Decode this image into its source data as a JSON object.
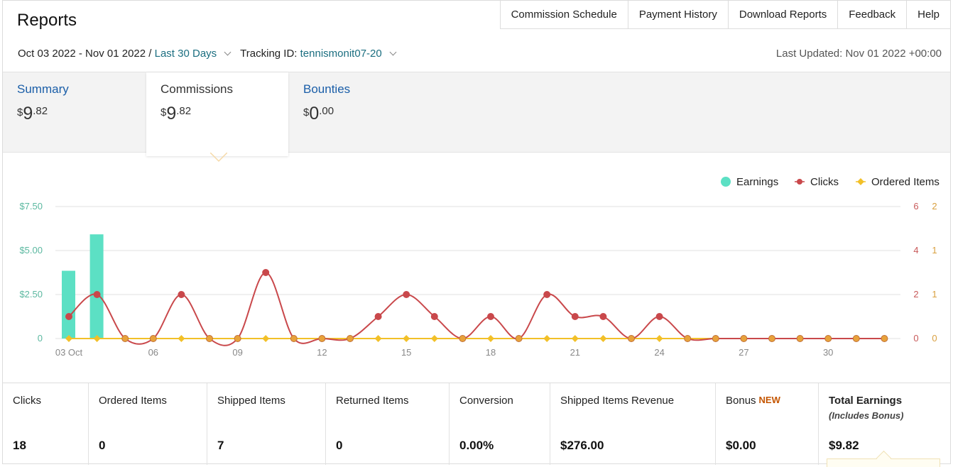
{
  "header": {
    "title": "Reports",
    "links": [
      "Commission Schedule",
      "Payment History",
      "Download Reports",
      "Feedback",
      "Help"
    ]
  },
  "filters": {
    "date_range": "Oct 03 2022 - Nov 01 2022 /",
    "period": "Last 30 Days",
    "tracking_label": "Tracking ID:",
    "tracking_id": "tennismonit07-20",
    "last_updated": "Last Updated: Nov 01 2022 +00:00"
  },
  "tabs": [
    {
      "label": "Summary",
      "currency": "$",
      "int": "9",
      "dec": ".82",
      "active": false
    },
    {
      "label": "Commissions",
      "currency": "$",
      "int": "9",
      "dec": ".82",
      "active": true
    },
    {
      "label": "Bounties",
      "currency": "$",
      "int": "0",
      "dec": ".00",
      "active": false
    }
  ],
  "chart_data": {
    "type": "bar",
    "legend": [
      "Earnings",
      "Clicks",
      "Ordered Items"
    ],
    "legend_position": "top-right",
    "colors": {
      "earnings": "#5ce0c4",
      "clicks": "#c9484b",
      "ordered": "#f2c028",
      "grid": "#e2e2e2"
    },
    "x_tick_labels": [
      "03 Oct",
      "06",
      "09",
      "12",
      "15",
      "18",
      "21",
      "24",
      "27",
      "30"
    ],
    "y_left_ticks": [
      "0",
      "$2.50",
      "$5.00",
      "$7.50"
    ],
    "y_left_range": [
      0,
      7.5
    ],
    "y_right1_ticks": [
      "0",
      "2",
      "4",
      "6"
    ],
    "y_right1_range": [
      0,
      6
    ],
    "y_right2_ticks": [
      "0",
      "1",
      "1",
      "2"
    ],
    "grid": true,
    "days": 30,
    "earnings": [
      3.85,
      5.92,
      0,
      0,
      0,
      0,
      0,
      0,
      0,
      0,
      0,
      0,
      0,
      0,
      0,
      0,
      0,
      0,
      0,
      0,
      0,
      0,
      0,
      0,
      0,
      0,
      0,
      0,
      0,
      0
    ],
    "clicks": [
      1,
      2,
      0,
      0,
      2,
      0,
      0,
      3,
      0,
      0,
      0,
      1,
      2,
      1,
      0,
      1,
      0,
      2,
      1,
      1,
      0,
      1,
      0,
      0,
      0,
      0,
      0,
      0,
      0,
      0
    ],
    "ordered_items": [
      0,
      0,
      0,
      0,
      0,
      0,
      0,
      0,
      0,
      0,
      0,
      0,
      0,
      0,
      0,
      0,
      0,
      0,
      0,
      0,
      0,
      0,
      0,
      0,
      0,
      0,
      0,
      0,
      0,
      0
    ]
  },
  "stats": [
    {
      "label": "Clicks",
      "value": "18"
    },
    {
      "label": "Ordered Items",
      "value": "0"
    },
    {
      "label": "Shipped Items",
      "value": "7"
    },
    {
      "label": "Returned Items",
      "value": "0"
    },
    {
      "label": "Conversion",
      "value": "0.00%"
    },
    {
      "label": "Shipped Items Revenue",
      "value": "$276.00"
    },
    {
      "label": "Bonus",
      "badge": "NEW",
      "value": "$0.00"
    },
    {
      "label": "Total Earnings",
      "sub": "(Includes Bonus)",
      "value": "$9.82"
    }
  ]
}
